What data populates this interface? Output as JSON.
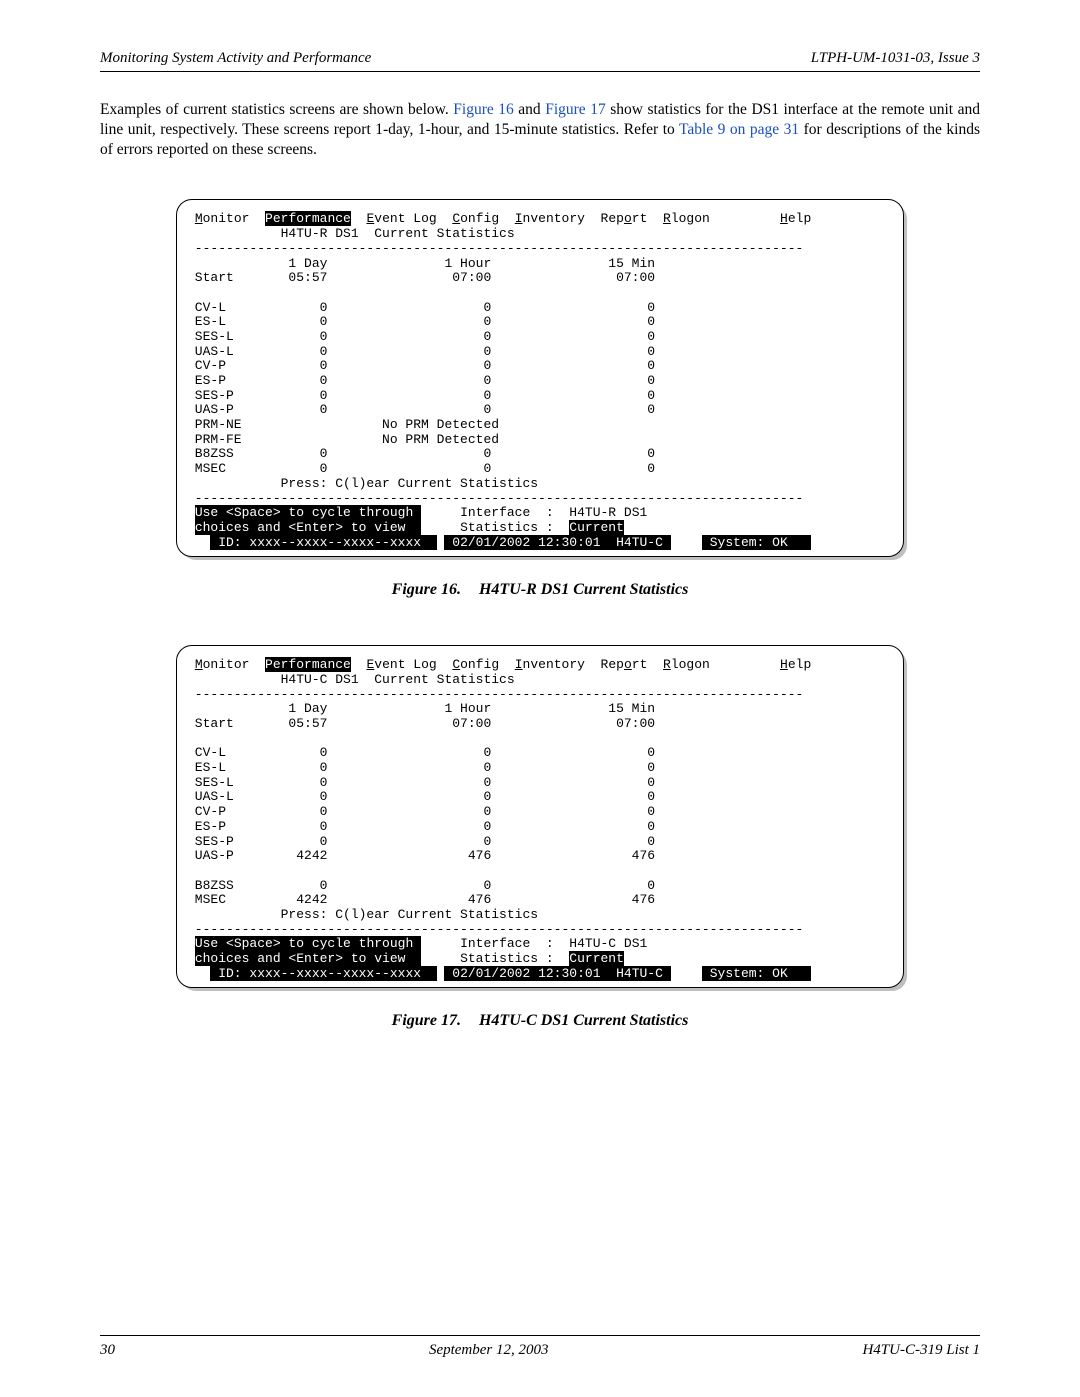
{
  "header": {
    "section": "Monitoring System Activity and Performance",
    "docid": "LTPH-UM-1031-03, Issue 3"
  },
  "intro": {
    "before_f16": "Examples of current statistics screens are shown below. ",
    "fig16": "Figure 16",
    "mid1": " and ",
    "fig17": "Figure 17",
    "after_f17": " show statistics for the DS1 interface at the remote unit and line unit, respectively. These screens report 1-day, 1-hour, and 15-minute statistics. Refer to ",
    "table9": "Table 9 on page 31",
    "after_t9": " for descriptions of the kinds of errors reported on these screens."
  },
  "menu": {
    "m1_u": "M",
    "m1_r": "onitor",
    "m2_u": "P",
    "m2_r": "erformance",
    "m3_u": "E",
    "m3_r": "vent Log",
    "m4_u": "C",
    "m4_r": "onfig",
    "m5_u": "I",
    "m5_r": "nventory",
    "m6_l": "Rep",
    "m6_u": "o",
    "m6_r": "rt",
    "m7_u": "R",
    "m7_r": "logon",
    "m8_u": "H",
    "m8_r": "elp"
  },
  "screen1": {
    "title": "H4TU-R DS1  Current Statistics",
    "col_day": "1 Day",
    "col_hour": "1 Hour",
    "col_min": "15 Min",
    "start_label": "Start",
    "start_day": "05:57",
    "start_hour": "07:00",
    "start_min": "07:00",
    "rows": [
      {
        "label": "CV-L",
        "day": "0",
        "hour": "0",
        "min": "0"
      },
      {
        "label": "ES-L",
        "day": "0",
        "hour": "0",
        "min": "0"
      },
      {
        "label": "SES-L",
        "day": "0",
        "hour": "0",
        "min": "0"
      },
      {
        "label": "UAS-L",
        "day": "0",
        "hour": "0",
        "min": "0"
      },
      {
        "label": "CV-P",
        "day": "0",
        "hour": "0",
        "min": "0"
      },
      {
        "label": "ES-P",
        "day": "0",
        "hour": "0",
        "min": "0"
      },
      {
        "label": "SES-P",
        "day": "0",
        "hour": "0",
        "min": "0"
      },
      {
        "label": "UAS-P",
        "day": "0",
        "hour": "0",
        "min": "0"
      }
    ],
    "prm_ne_label": "PRM-NE",
    "prm_ne_text": "No PRM Detected",
    "prm_fe_label": "PRM-FE",
    "prm_fe_text": "No PRM Detected",
    "b8zss": {
      "label": "B8ZSS",
      "day": "0",
      "hour": "0",
      "min": "0"
    },
    "msec": {
      "label": "MSEC",
      "day": "0",
      "hour": "0",
      "min": "0"
    },
    "press": "Press: C(l)ear Current Statistics",
    "hint1": "Use <Space> to cycle through",
    "hint2": "choices and <Enter> to view ",
    "iface_label": "Interface  :",
    "iface_val": "H4TU-R DS1",
    "stats_label": "Statistics :",
    "stats_val": "Current",
    "id_label": "ID:",
    "id_val": "xxxx--xxxx--xxxx--xxxx",
    "ts": "02/01/2002 12:30:01",
    "unit": "H4TU-C",
    "sys": "System: OK"
  },
  "fig16": {
    "no": "Figure 16.",
    "title": "H4TU-R DS1 Current Statistics"
  },
  "screen2": {
    "title": "H4TU-C DS1  Current Statistics",
    "col_day": "1 Day",
    "col_hour": "1 Hour",
    "col_min": "15 Min",
    "start_label": "Start",
    "start_day": "05:57",
    "start_hour": "07:00",
    "start_min": "07:00",
    "rows": [
      {
        "label": "CV-L",
        "day": "0",
        "hour": "0",
        "min": "0"
      },
      {
        "label": "ES-L",
        "day": "0",
        "hour": "0",
        "min": "0"
      },
      {
        "label": "SES-L",
        "day": "0",
        "hour": "0",
        "min": "0"
      },
      {
        "label": "UAS-L",
        "day": "0",
        "hour": "0",
        "min": "0"
      },
      {
        "label": "CV-P",
        "day": "0",
        "hour": "0",
        "min": "0"
      },
      {
        "label": "ES-P",
        "day": "0",
        "hour": "0",
        "min": "0"
      },
      {
        "label": "SES-P",
        "day": "0",
        "hour": "0",
        "min": "0"
      },
      {
        "label": "UAS-P",
        "day": "4242",
        "hour": "476",
        "min": "476"
      }
    ],
    "b8zss": {
      "label": "B8ZSS",
      "day": "0",
      "hour": "0",
      "min": "0"
    },
    "msec": {
      "label": "MSEC",
      "day": "4242",
      "hour": "476",
      "min": "476"
    },
    "press": "Press: C(l)ear Current Statistics",
    "hint1": "Use <Space> to cycle through",
    "hint2": "choices and <Enter> to view ",
    "iface_label": "Interface  :",
    "iface_val": "H4TU-C DS1",
    "stats_label": "Statistics :",
    "stats_val": "Current",
    "id_label": "ID:",
    "id_val": "xxxx--xxxx--xxxx--xxxx",
    "ts": "02/01/2002 12:30:01",
    "unit": "H4TU-C",
    "sys": "System: OK"
  },
  "fig17": {
    "no": "Figure 17.",
    "title": "H4TU-C DS1 Current Statistics"
  },
  "footer": {
    "page": "30",
    "date": "September 12, 2003",
    "product": "H4TU-C-319 List 1"
  }
}
